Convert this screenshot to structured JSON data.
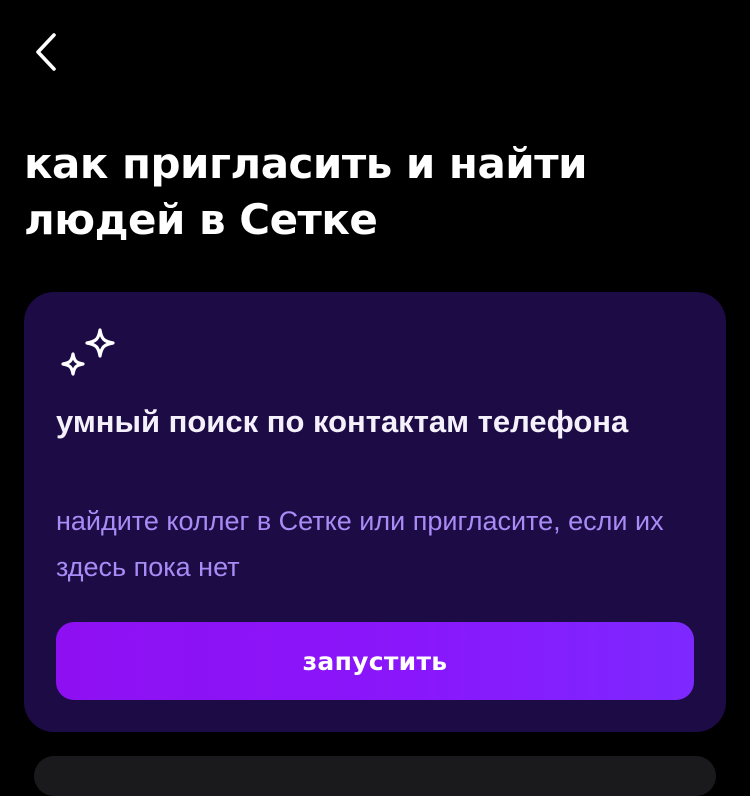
{
  "header": {
    "back_icon": "chevron-left-icon"
  },
  "page": {
    "title": "как пригласить и найти людей в Сетке"
  },
  "card": {
    "icon": "sparkles-icon",
    "title": "умный поиск по контактам телефона",
    "description": "найдите коллег в Сетке или пригласите, если их здесь пока нет",
    "button_label": "запустить"
  },
  "colors": {
    "background": "#000000",
    "card_background": "#1c0b45",
    "description_text": "#a98bf5",
    "button_gradient_start": "#8e10f2",
    "button_gradient_end": "#7d28ff"
  }
}
